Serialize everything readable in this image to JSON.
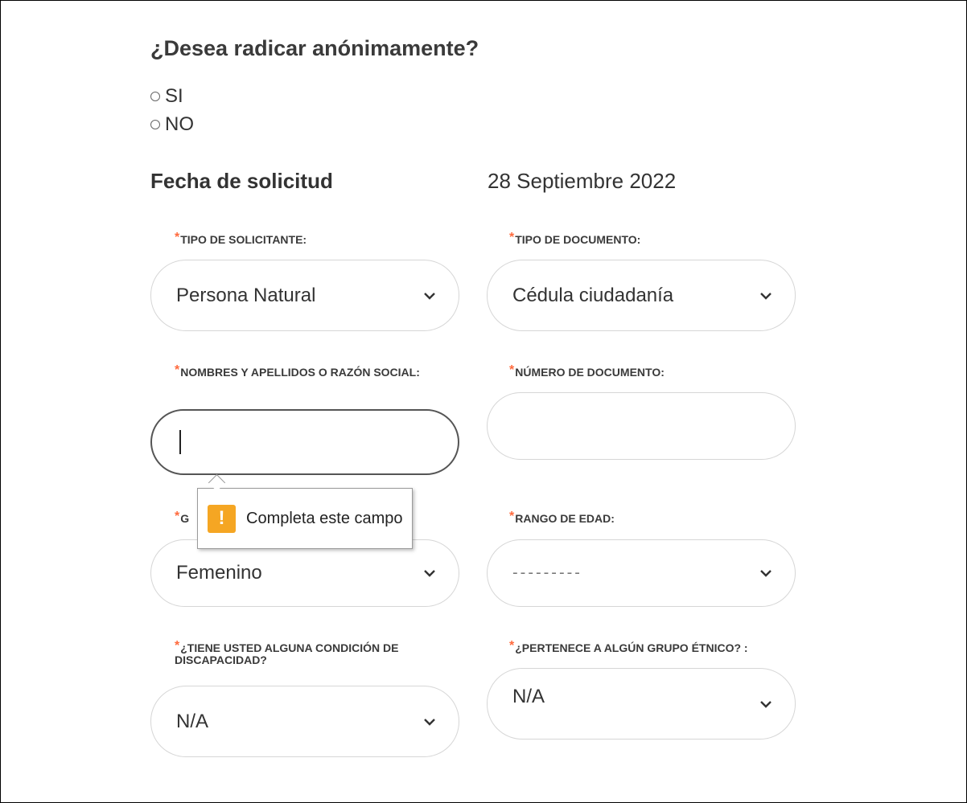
{
  "anonymous": {
    "question": "¿Desea radicar anónimamente?",
    "options": [
      "SI",
      "NO"
    ]
  },
  "request_date": {
    "label": "Fecha de solicitud",
    "value": "28 Septiembre 2022"
  },
  "fields": {
    "applicant_type": {
      "label": "TIPO DE SOLICITANTE:",
      "value": "Persona Natural"
    },
    "document_type": {
      "label": "TIPO DE DOCUMENTO:",
      "value": "Cédula ciudadanía"
    },
    "full_name": {
      "label": "NOMBRES Y APELLIDOS O RAZÓN SOCIAL:",
      "value": ""
    },
    "document_number": {
      "label": "NÚMERO DE DOCUMENTO:",
      "value": ""
    },
    "gender": {
      "label": "G",
      "value": "Femenino"
    },
    "age_range": {
      "label": "RANGO DE EDAD:",
      "value": "---------"
    },
    "disability": {
      "label": "¿TIENE USTED ALGUNA CONDICIÓN DE DISCAPACIDAD?",
      "value": "N/A"
    },
    "ethnic_group": {
      "label": "¿PERTENECE A ALGÚN GRUPO ÉTNICO? :",
      "value": "N/A"
    }
  },
  "tooltip": {
    "icon": "!",
    "text": "Completa este campo"
  },
  "colors": {
    "required_asterisk": "#ff6a3d",
    "warning": "#f5a623"
  }
}
